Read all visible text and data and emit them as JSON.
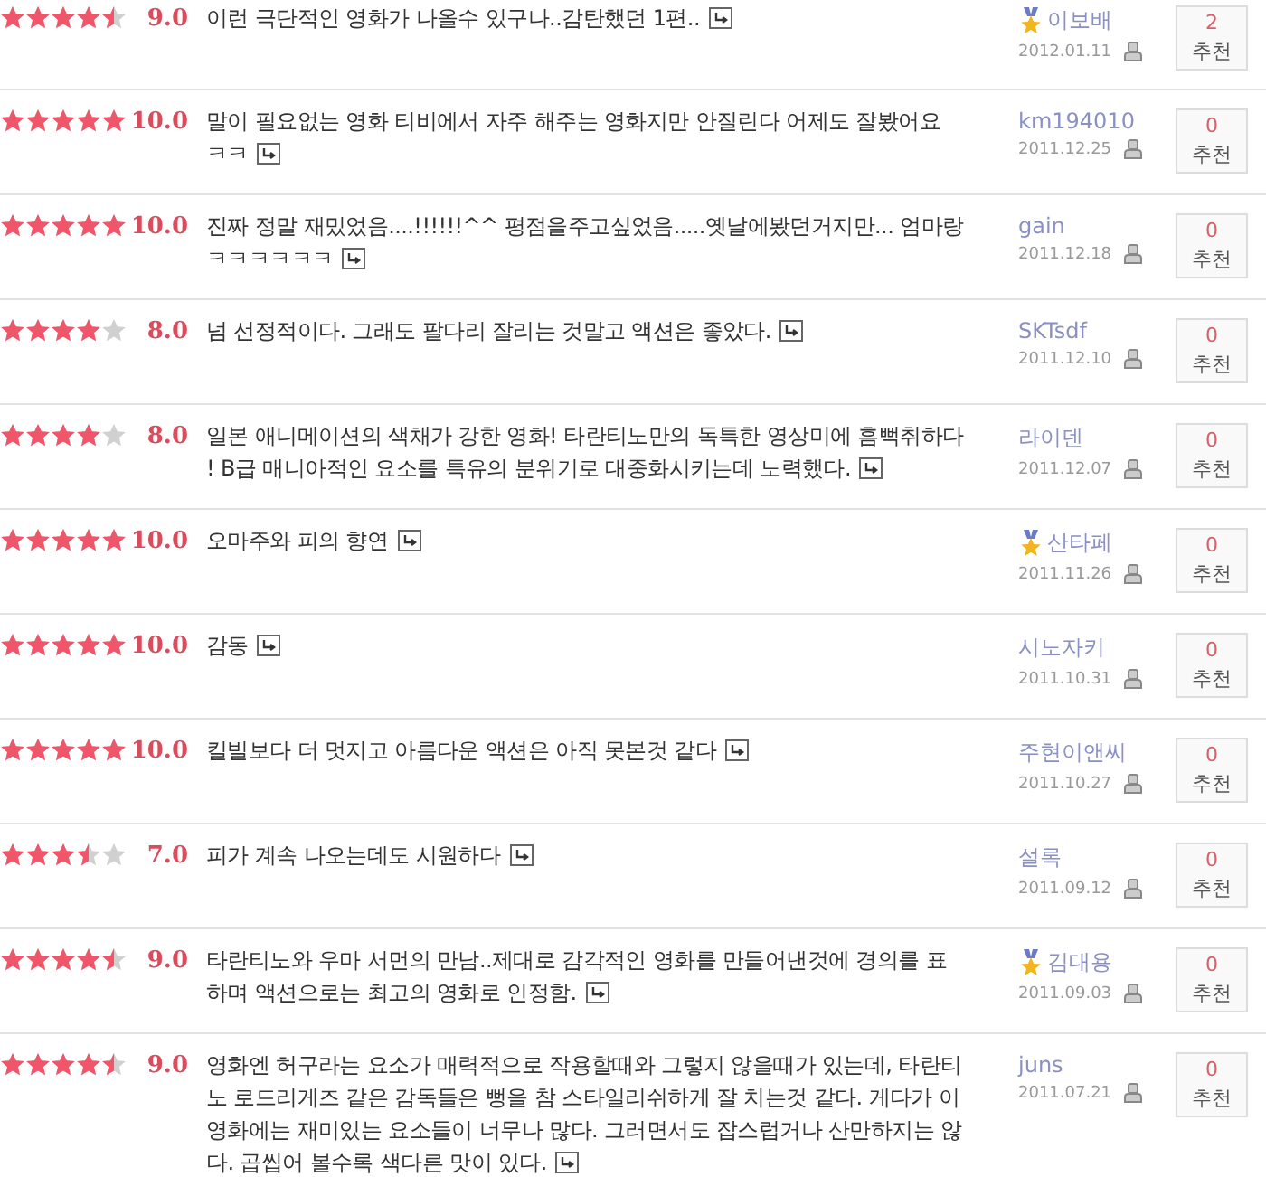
{
  "reviews": [
    {
      "stars": 4.5,
      "score": "9.0",
      "lines": [
        "이런 극단적인 영화가 나올수 있구나..감탄했던 1편.."
      ],
      "author": "이보배",
      "medal": true,
      "date": "2012.01.11",
      "count": "2",
      "button": "추천"
    },
    {
      "stars": 5,
      "score": "10.0",
      "lines": [
        "말이 필요없는 영화 티비에서 자주 해주는 영화지만 안질린다 어제도 잘봤어요",
        "ㅋㅋ"
      ],
      "author": "km194010",
      "medal": false,
      "date": "2011.12.25",
      "count": "0",
      "button": "추천"
    },
    {
      "stars": 5,
      "score": "10.0",
      "lines": [
        "진짜 정말 재밌었음....!!!!!!^^ 평점을주고싶었음.....옛날에봤던거지만... 엄마랑",
        "ㅋㅋㅋㅋㅋㅋ"
      ],
      "author": "gain",
      "medal": false,
      "date": "2011.12.18",
      "count": "0",
      "button": "추천"
    },
    {
      "stars": 4,
      "score": "8.0",
      "lines": [
        "넘 선정적이다. 그래도 팔다리 잘리는 것말고 액션은 좋았다."
      ],
      "author": "SKTsdf",
      "medal": false,
      "date": "2011.12.10",
      "count": "0",
      "button": "추천"
    },
    {
      "stars": 4,
      "score": "8.0",
      "lines": [
        "일본 애니메이션의 색채가 강한 영화! 타란티노만의 독특한 영상미에 흠뻑취하다",
        "! B급 매니아적인 요소를 특유의 분위기로 대중화시키는데 노력했다."
      ],
      "author": "라이덴",
      "medal": false,
      "date": "2011.12.07",
      "count": "0",
      "button": "추천"
    },
    {
      "stars": 5,
      "score": "10.0",
      "lines": [
        "오마주와 피의 향연"
      ],
      "author": "산타페",
      "medal": true,
      "date": "2011.11.26",
      "count": "0",
      "button": "추천"
    },
    {
      "stars": 5,
      "score": "10.0",
      "lines": [
        "감동"
      ],
      "author": "시노자키",
      "medal": false,
      "date": "2011.10.31",
      "count": "0",
      "button": "추천"
    },
    {
      "stars": 5,
      "score": "10.0",
      "lines": [
        "킬빌보다 더 멋지고 아름다운 액션은 아직 못본것 같다"
      ],
      "author": "주현이앤씨",
      "medal": false,
      "date": "2011.10.27",
      "count": "0",
      "button": "추천"
    },
    {
      "stars": 3.5,
      "score": "7.0",
      "lines": [
        "피가 계속 나오는데도 시원하다"
      ],
      "author": "설록",
      "medal": false,
      "date": "2011.09.12",
      "count": "0",
      "button": "추천"
    },
    {
      "stars": 4.5,
      "score": "9.0",
      "lines": [
        "타란티노와 우마 서먼의 만남..제대로 감각적인 영화를 만들어낸것에 경의를 표",
        "하며 액션으로는 최고의 영화로 인정함."
      ],
      "author": "김대용",
      "medal": true,
      "date": "2011.09.03",
      "count": "0",
      "button": "추천"
    },
    {
      "stars": 4.5,
      "score": "9.0",
      "lines": [
        "영화엔 허구라는 요소가 매력적으로 작용할때와 그렇지 않을때가 있는데, 타란티",
        "노 로드리게즈 같은 감독들은 뻥을 참 스타일리쉬하게 잘 치는것 같다. 게다가 이",
        "영화에는 재미있는 요소들이 너무나 많다. 그러면서도 잡스럽거나 산만하지는 않",
        "다. 곱씹어 볼수록 색다른 맛이 있다."
      ],
      "author": "juns",
      "medal": false,
      "date": "2011.07.21",
      "count": "0",
      "button": "추천"
    }
  ]
}
